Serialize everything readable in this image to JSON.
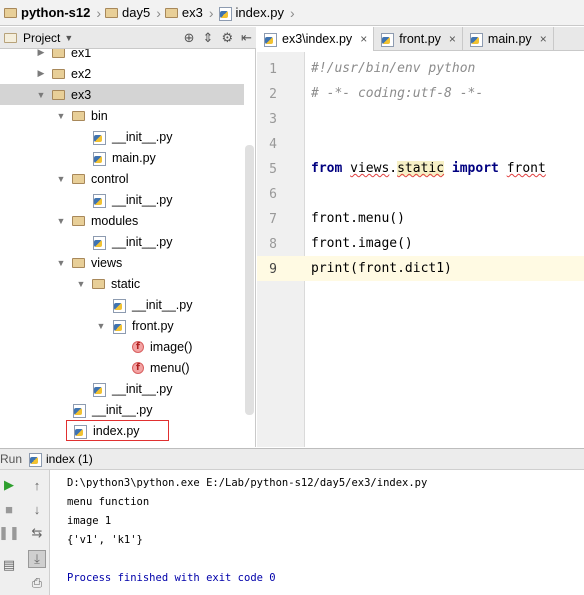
{
  "breadcrumb": [
    "python-s12",
    "day5",
    "ex3",
    "index.py"
  ],
  "project_panel": {
    "title": "Project"
  },
  "tree": [
    {
      "label": "ex1",
      "kind": "folder",
      "arrow": "right"
    },
    {
      "label": "ex2",
      "kind": "folder",
      "arrow": "right"
    },
    {
      "label": "ex3",
      "kind": "folder",
      "arrow": "down",
      "selected": true
    },
    {
      "label": "bin",
      "kind": "folder",
      "arrow": "down"
    },
    {
      "label": "__init__.py",
      "kind": "py"
    },
    {
      "label": "main.py",
      "kind": "py"
    },
    {
      "label": "control",
      "kind": "folder",
      "arrow": "down"
    },
    {
      "label": "__init__.py",
      "kind": "py"
    },
    {
      "label": "modules",
      "kind": "folder",
      "arrow": "down"
    },
    {
      "label": "__init__.py",
      "kind": "py"
    },
    {
      "label": "views",
      "kind": "folder",
      "arrow": "down"
    },
    {
      "label": "static",
      "kind": "folder",
      "arrow": "down"
    },
    {
      "label": "__init__.py",
      "kind": "py"
    },
    {
      "label": "front.py",
      "kind": "py",
      "arrow": "down"
    },
    {
      "label": "image()",
      "kind": "func"
    },
    {
      "label": "menu()",
      "kind": "func"
    },
    {
      "label": "__init__.py",
      "kind": "py"
    },
    {
      "label": "__init__.py",
      "kind": "py"
    },
    {
      "label": "index.py",
      "kind": "py",
      "boxed": true
    }
  ],
  "tabs": [
    {
      "label": "ex3\\index.py",
      "active": true
    },
    {
      "label": "front.py",
      "active": false
    },
    {
      "label": "main.py",
      "active": false
    }
  ],
  "editor": {
    "current_line": 9,
    "lines": [
      {
        "no": "1",
        "text": "#!/usr/bin/env python"
      },
      {
        "no": "2",
        "text": "# -*- coding:utf-8 -*-"
      },
      {
        "no": "3",
        "text": ""
      },
      {
        "no": "4",
        "text": ""
      },
      {
        "no": "5",
        "text": "from views.static import front"
      },
      {
        "no": "6",
        "text": ""
      },
      {
        "no": "7",
        "text": "front.menu()"
      },
      {
        "no": "8",
        "text": "front.image()"
      },
      {
        "no": "9",
        "text": "print(front.dict1)"
      }
    ]
  },
  "run": {
    "label": "Run",
    "config": "index (1)",
    "output": [
      "D:\\python3\\python.exe E:/Lab/python-s12/day5/ex3/index.py",
      "menu function",
      "image 1",
      "{'v1', 'k1'}",
      "",
      "Process finished with exit code 0"
    ]
  },
  "colors": {
    "keyword": "#000080",
    "comment": "#8c8c8c",
    "current_line": "#fffae3",
    "selection": "#d4d4d4",
    "process_text": "#0000aa"
  }
}
